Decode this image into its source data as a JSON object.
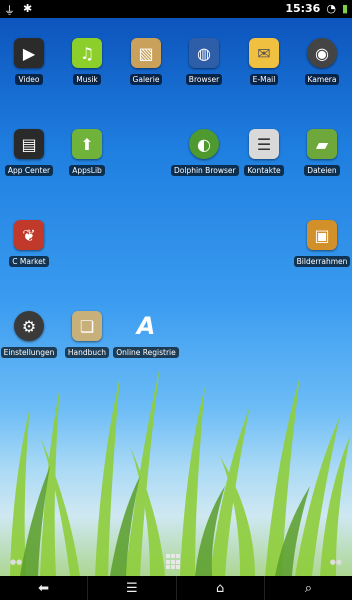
{
  "status_bar": {
    "time": "15:36",
    "left_icons": [
      "usb-icon",
      "bug-icon"
    ],
    "right_icons": [
      "wifi-icon",
      "battery-icon"
    ]
  },
  "apps": [
    {
      "label": "Video",
      "icon": "video-icon",
      "color": "#2b2b2b"
    },
    {
      "label": "Musik",
      "icon": "music-icon",
      "color": "#8ccf2a"
    },
    {
      "label": "Galerie",
      "icon": "gallery-icon",
      "color": "#c9a15a"
    },
    {
      "label": "Browser",
      "icon": "globe-icon",
      "color": "#2f5ea8"
    },
    {
      "label": "E-Mail",
      "icon": "email-icon",
      "color": "#f0c040"
    },
    {
      "label": "Kamera",
      "icon": "camera-icon",
      "color": "#444444"
    },
    {
      "label": "App Center",
      "icon": "app-center-icon",
      "color": "#2a2a2a"
    },
    {
      "label": "AppsLib",
      "icon": "appslib-icon",
      "color": "#6fb33a"
    },
    {
      "label": "Dolphin Browser",
      "icon": "dolphin-icon",
      "color": "#4e9a2f"
    },
    {
      "label": "Kontakte",
      "icon": "contacts-icon",
      "color": "#d9d9d9"
    },
    {
      "label": "Dateien",
      "icon": "folder-icon",
      "color": "#6ea83a"
    },
    {
      "label": "C Market",
      "icon": "plant-icon",
      "color": "#c0392b"
    },
    {
      "label": "Bilderrahmen",
      "icon": "picture-frame-icon",
      "color": "#d1902a"
    },
    {
      "label": "Einstellungen",
      "icon": "settings-icon",
      "color": "#3a3a3a"
    },
    {
      "label": "Handbuch",
      "icon": "manual-icon",
      "color": "#c7b07a"
    },
    {
      "label": "Online Registrie",
      "icon": "registration-icon",
      "color": "#1a4f9e"
    }
  ],
  "navbar": {
    "buttons": [
      "back-icon",
      "menu-icon",
      "home-icon",
      "search-icon"
    ]
  }
}
